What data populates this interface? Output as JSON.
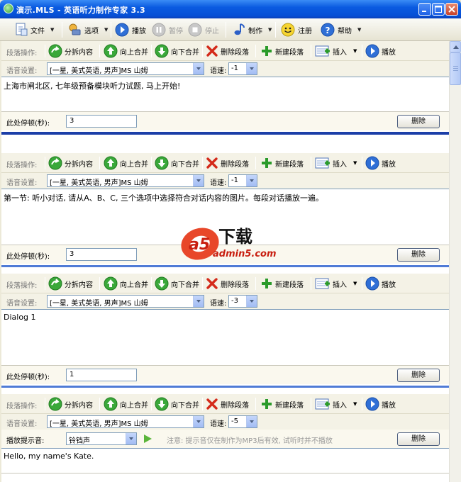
{
  "window": {
    "title": "演示.MLS - 英语听力制作专家 3.3"
  },
  "toolbar": {
    "file": "文件",
    "options": "选项",
    "play": "播放",
    "pause": "暂停",
    "stop": "停止",
    "make": "制作",
    "register": "注册",
    "help": "帮助"
  },
  "labels": {
    "segment_ops": "段落操作:",
    "voice_settings": "语音设置:",
    "speed": "语速:",
    "pause_seconds": "此处停顿(秒):",
    "play_hint_sound": "播放提示音:",
    "split": "分拆内容",
    "merge_up": "向上合并",
    "merge_down": "向下合并",
    "delete_segment": "删除段落",
    "new_segment": "新建段落",
    "insert": "插入",
    "play": "播放",
    "delete": "删除"
  },
  "segments": [
    {
      "voice": "[一星, 美式英语, 男声]MS 山姆",
      "speed": "-1",
      "text": "上海市闸北区, 七年级预备模块听力试题, 马上开始!",
      "pause": "3"
    },
    {
      "voice": "[一星, 美式英语, 男声]MS 山姆",
      "speed": "-1",
      "text": "第一节: 听小对话,  请从A、B、C, 三个选项中选择符合对话内容的图片。每段对话播放一遍。",
      "pause": "3"
    },
    {
      "voice": "[一星, 美式英语, 男声]MS 山姆",
      "speed": "-3",
      "text": "Dialog 1",
      "pause": "1"
    },
    {
      "voice": "[一星, 美式英语, 男声]MS 山姆",
      "speed": "-5",
      "hint_sound": "铃铛声",
      "hint_note": "注意: 提示音仅在制作为MP3后有效, 试听时并不播放",
      "text": "Hello, my name's Kate."
    }
  ],
  "watermark": {
    "brand": "a5",
    "subtitle": "下载",
    "site": "admin5.com"
  },
  "colors": {
    "titlebar": "#0a5ae0",
    "divider": "#1b3ea8",
    "panel": "#f4f2e6"
  }
}
